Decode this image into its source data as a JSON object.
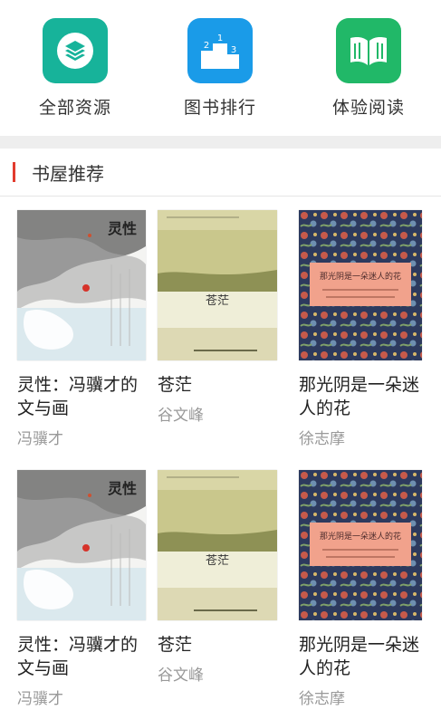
{
  "nav": [
    {
      "label": "全部资源",
      "icon": "layers-icon",
      "color": "#17b39a"
    },
    {
      "label": "图书排行",
      "icon": "podium-icon",
      "color": "#1a9be8"
    },
    {
      "label": "体验阅读",
      "icon": "open-book-icon",
      "color": "#21b868"
    }
  ],
  "section": {
    "title": "书屋推荐"
  },
  "books": [
    {
      "title": "灵性：冯骥才的文与画",
      "author": "冯骥才",
      "cover_text": "灵性"
    },
    {
      "title": "苍茫",
      "author": "谷文峰",
      "cover_text": "苍茫"
    },
    {
      "title": "那光阴是一朵迷人的花",
      "author": "徐志摩",
      "cover_text": "那光阴是一朵迷人的花"
    },
    {
      "title": "灵性：冯骥才的文与画",
      "author": "冯骥才",
      "cover_text": "灵性"
    },
    {
      "title": "苍茫",
      "author": "谷文峰",
      "cover_text": "苍茫"
    },
    {
      "title": "那光阴是一朵迷人的花",
      "author": "徐志摩",
      "cover_text": "那光阴是一朵迷人的花"
    }
  ]
}
